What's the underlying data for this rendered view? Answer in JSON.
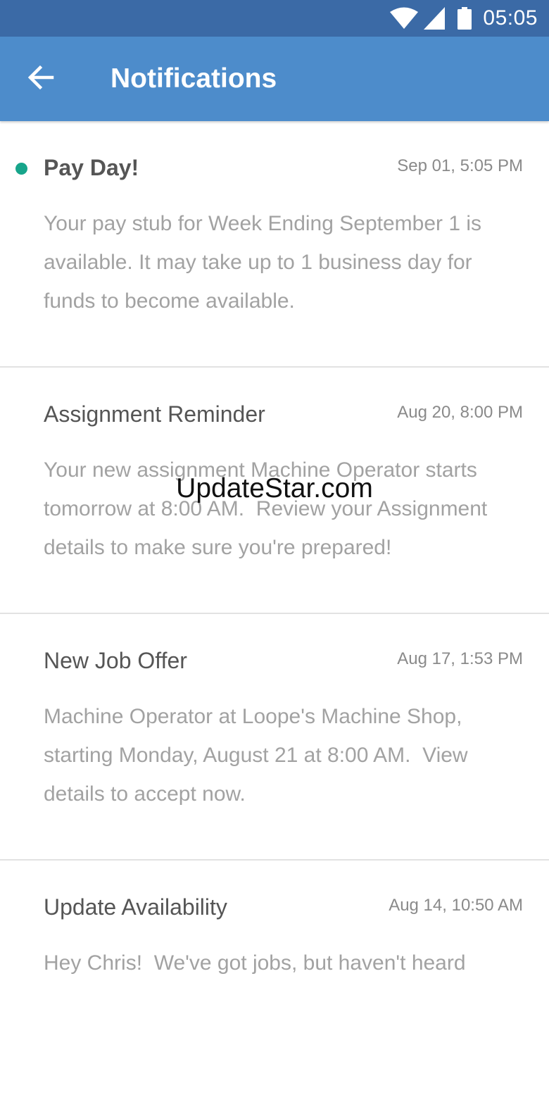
{
  "status_bar": {
    "time": "05:05",
    "icons": [
      "wifi-icon",
      "cell-signal-icon",
      "battery-icon"
    ]
  },
  "app_bar": {
    "back_icon": "arrow-left-icon",
    "title": "Notifications"
  },
  "notifications": [
    {
      "unread": true,
      "title": "Pay Day!",
      "time": "Sep 01, 5:05 PM",
      "body": "Your pay stub for Week Ending September 1 is available. It may take up to 1 business day for funds to become available."
    },
    {
      "unread": false,
      "title": "Assignment Reminder",
      "time": "Aug 20, 8:00 PM",
      "body": "Your new assignment Machine Operator starts tomorrow at 8:00 AM.  Review your Assignment details to make sure you're prepared!"
    },
    {
      "unread": false,
      "title": "New Job Offer",
      "time": "Aug 17, 1:53 PM",
      "body": "Machine Operator at Loope's Machine Shop, starting Monday, August 21 at 8:00 AM.  View details to accept now."
    },
    {
      "unread": false,
      "title": "Update Availability",
      "time": "Aug 14, 10:50 AM",
      "body": "Hey Chris!  We've got jobs, but haven't heard"
    }
  ],
  "watermark": "UpdateStar.com",
  "colors": {
    "status_bar": "#3b6aa6",
    "app_bar": "#4d8ccb",
    "unread_dot": "#17a58b",
    "title_text": "#555555",
    "body_text": "#a2a2a2",
    "divider": "#e2e2e2"
  }
}
